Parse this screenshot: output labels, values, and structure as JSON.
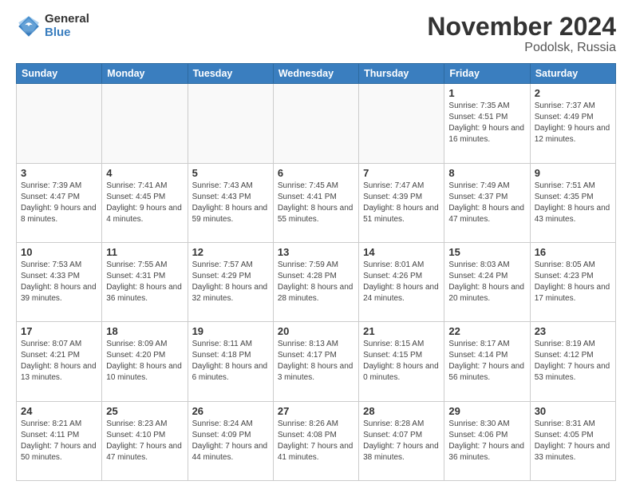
{
  "logo": {
    "general": "General",
    "blue": "Blue"
  },
  "title": "November 2024",
  "subtitle": "Podolsk, Russia",
  "headers": [
    "Sunday",
    "Monday",
    "Tuesday",
    "Wednesday",
    "Thursday",
    "Friday",
    "Saturday"
  ],
  "weeks": [
    [
      {
        "day": "",
        "info": ""
      },
      {
        "day": "",
        "info": ""
      },
      {
        "day": "",
        "info": ""
      },
      {
        "day": "",
        "info": ""
      },
      {
        "day": "",
        "info": ""
      },
      {
        "day": "1",
        "info": "Sunrise: 7:35 AM\nSunset: 4:51 PM\nDaylight: 9 hours and 16 minutes."
      },
      {
        "day": "2",
        "info": "Sunrise: 7:37 AM\nSunset: 4:49 PM\nDaylight: 9 hours and 12 minutes."
      }
    ],
    [
      {
        "day": "3",
        "info": "Sunrise: 7:39 AM\nSunset: 4:47 PM\nDaylight: 9 hours and 8 minutes."
      },
      {
        "day": "4",
        "info": "Sunrise: 7:41 AM\nSunset: 4:45 PM\nDaylight: 9 hours and 4 minutes."
      },
      {
        "day": "5",
        "info": "Sunrise: 7:43 AM\nSunset: 4:43 PM\nDaylight: 8 hours and 59 minutes."
      },
      {
        "day": "6",
        "info": "Sunrise: 7:45 AM\nSunset: 4:41 PM\nDaylight: 8 hours and 55 minutes."
      },
      {
        "day": "7",
        "info": "Sunrise: 7:47 AM\nSunset: 4:39 PM\nDaylight: 8 hours and 51 minutes."
      },
      {
        "day": "8",
        "info": "Sunrise: 7:49 AM\nSunset: 4:37 PM\nDaylight: 8 hours and 47 minutes."
      },
      {
        "day": "9",
        "info": "Sunrise: 7:51 AM\nSunset: 4:35 PM\nDaylight: 8 hours and 43 minutes."
      }
    ],
    [
      {
        "day": "10",
        "info": "Sunrise: 7:53 AM\nSunset: 4:33 PM\nDaylight: 8 hours and 39 minutes."
      },
      {
        "day": "11",
        "info": "Sunrise: 7:55 AM\nSunset: 4:31 PM\nDaylight: 8 hours and 36 minutes."
      },
      {
        "day": "12",
        "info": "Sunrise: 7:57 AM\nSunset: 4:29 PM\nDaylight: 8 hours and 32 minutes."
      },
      {
        "day": "13",
        "info": "Sunrise: 7:59 AM\nSunset: 4:28 PM\nDaylight: 8 hours and 28 minutes."
      },
      {
        "day": "14",
        "info": "Sunrise: 8:01 AM\nSunset: 4:26 PM\nDaylight: 8 hours and 24 minutes."
      },
      {
        "day": "15",
        "info": "Sunrise: 8:03 AM\nSunset: 4:24 PM\nDaylight: 8 hours and 20 minutes."
      },
      {
        "day": "16",
        "info": "Sunrise: 8:05 AM\nSunset: 4:23 PM\nDaylight: 8 hours and 17 minutes."
      }
    ],
    [
      {
        "day": "17",
        "info": "Sunrise: 8:07 AM\nSunset: 4:21 PM\nDaylight: 8 hours and 13 minutes."
      },
      {
        "day": "18",
        "info": "Sunrise: 8:09 AM\nSunset: 4:20 PM\nDaylight: 8 hours and 10 minutes."
      },
      {
        "day": "19",
        "info": "Sunrise: 8:11 AM\nSunset: 4:18 PM\nDaylight: 8 hours and 6 minutes."
      },
      {
        "day": "20",
        "info": "Sunrise: 8:13 AM\nSunset: 4:17 PM\nDaylight: 8 hours and 3 minutes."
      },
      {
        "day": "21",
        "info": "Sunrise: 8:15 AM\nSunset: 4:15 PM\nDaylight: 8 hours and 0 minutes."
      },
      {
        "day": "22",
        "info": "Sunrise: 8:17 AM\nSunset: 4:14 PM\nDaylight: 7 hours and 56 minutes."
      },
      {
        "day": "23",
        "info": "Sunrise: 8:19 AM\nSunset: 4:12 PM\nDaylight: 7 hours and 53 minutes."
      }
    ],
    [
      {
        "day": "24",
        "info": "Sunrise: 8:21 AM\nSunset: 4:11 PM\nDaylight: 7 hours and 50 minutes."
      },
      {
        "day": "25",
        "info": "Sunrise: 8:23 AM\nSunset: 4:10 PM\nDaylight: 7 hours and 47 minutes."
      },
      {
        "day": "26",
        "info": "Sunrise: 8:24 AM\nSunset: 4:09 PM\nDaylight: 7 hours and 44 minutes."
      },
      {
        "day": "27",
        "info": "Sunrise: 8:26 AM\nSunset: 4:08 PM\nDaylight: 7 hours and 41 minutes."
      },
      {
        "day": "28",
        "info": "Sunrise: 8:28 AM\nSunset: 4:07 PM\nDaylight: 7 hours and 38 minutes."
      },
      {
        "day": "29",
        "info": "Sunrise: 8:30 AM\nSunset: 4:06 PM\nDaylight: 7 hours and 36 minutes."
      },
      {
        "day": "30",
        "info": "Sunrise: 8:31 AM\nSunset: 4:05 PM\nDaylight: 7 hours and 33 minutes."
      }
    ]
  ]
}
